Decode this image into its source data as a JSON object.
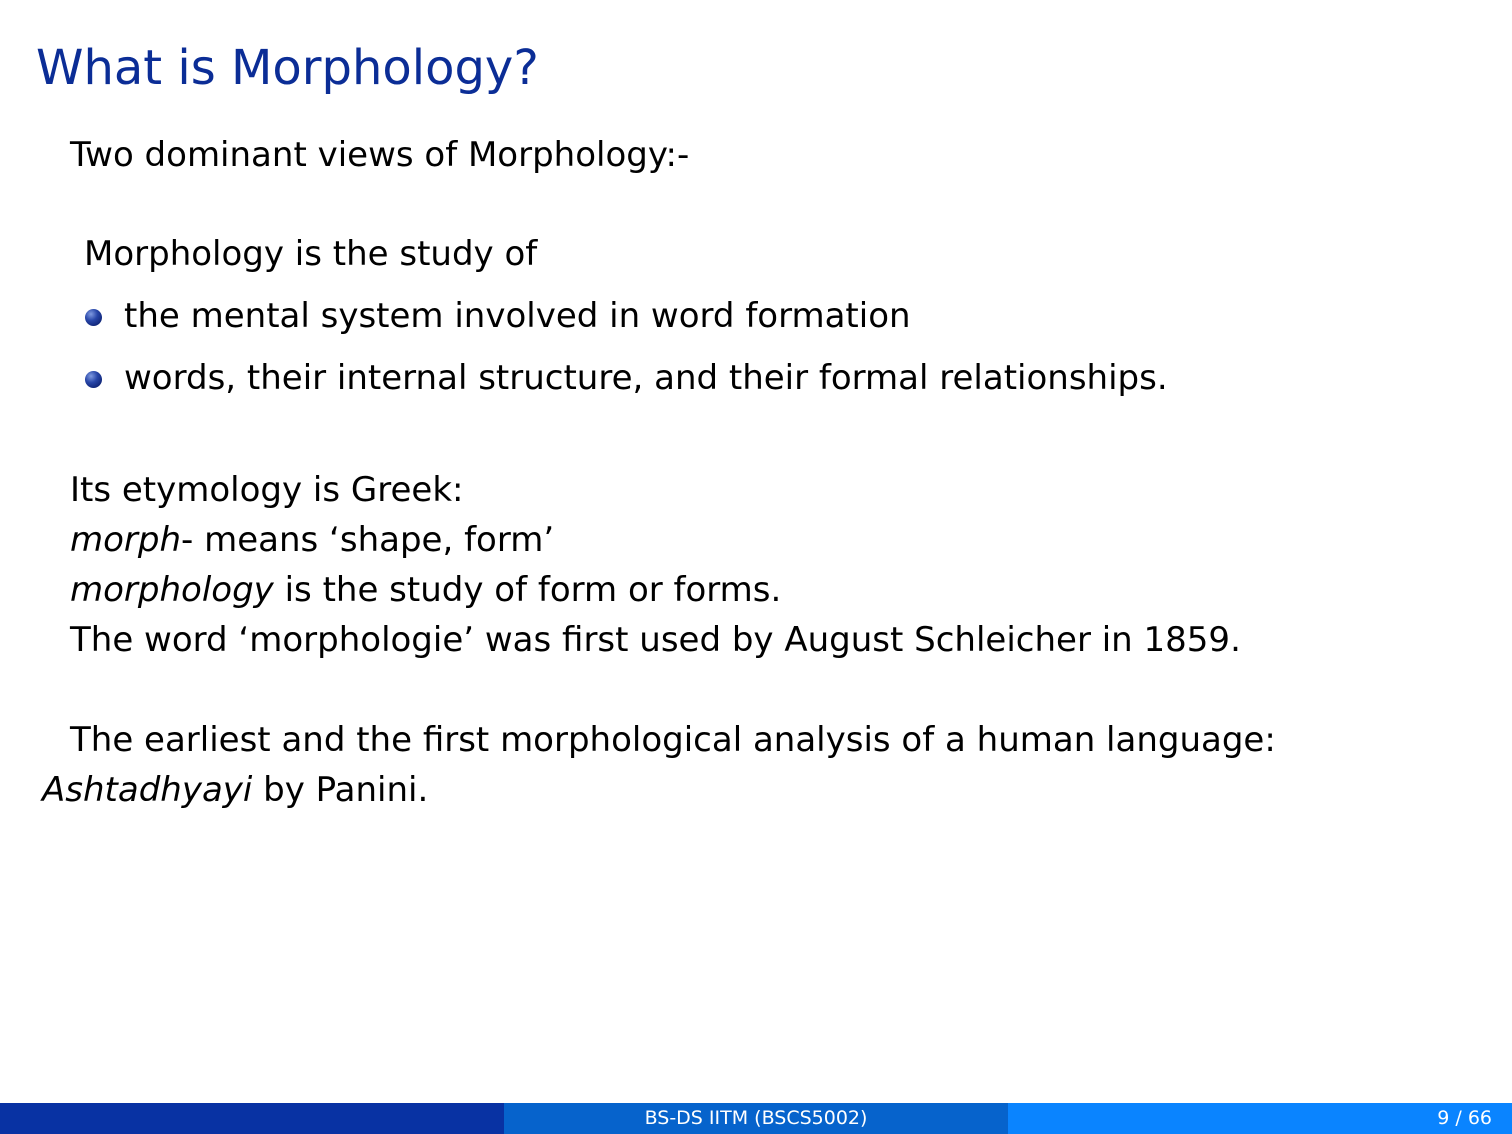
{
  "slide": {
    "title": "What is Morphology?",
    "intro": "Two dominant views of Morphology:-",
    "study_lead": "Morphology is the study of",
    "bullets": [
      "the mental system involved in word formation",
      "words, their internal structure, and their formal relationships."
    ],
    "etymology": {
      "line1": "Its etymology is Greek:",
      "line2_term": "morph",
      "line2_rest": "- means ‘shape, form’",
      "line3_term": "morphology",
      "line3_rest": " is the study of form or forms.",
      "line4": "The word ‘morphologie’ was first used by August Schleicher in 1859."
    },
    "earliest": {
      "line1": "The earliest and the first morphological analysis of a human language:",
      "work": "Ashtadhyayi",
      "rest": " by Panini."
    }
  },
  "footer": {
    "center": "BS-DS IITM (BSCS5002)",
    "page": "9 / 66"
  },
  "colors": {
    "title": "#0b2d96",
    "footer_left": "#0832a3",
    "footer_mid": "#0663cc",
    "footer_right": "#0a84ff"
  }
}
